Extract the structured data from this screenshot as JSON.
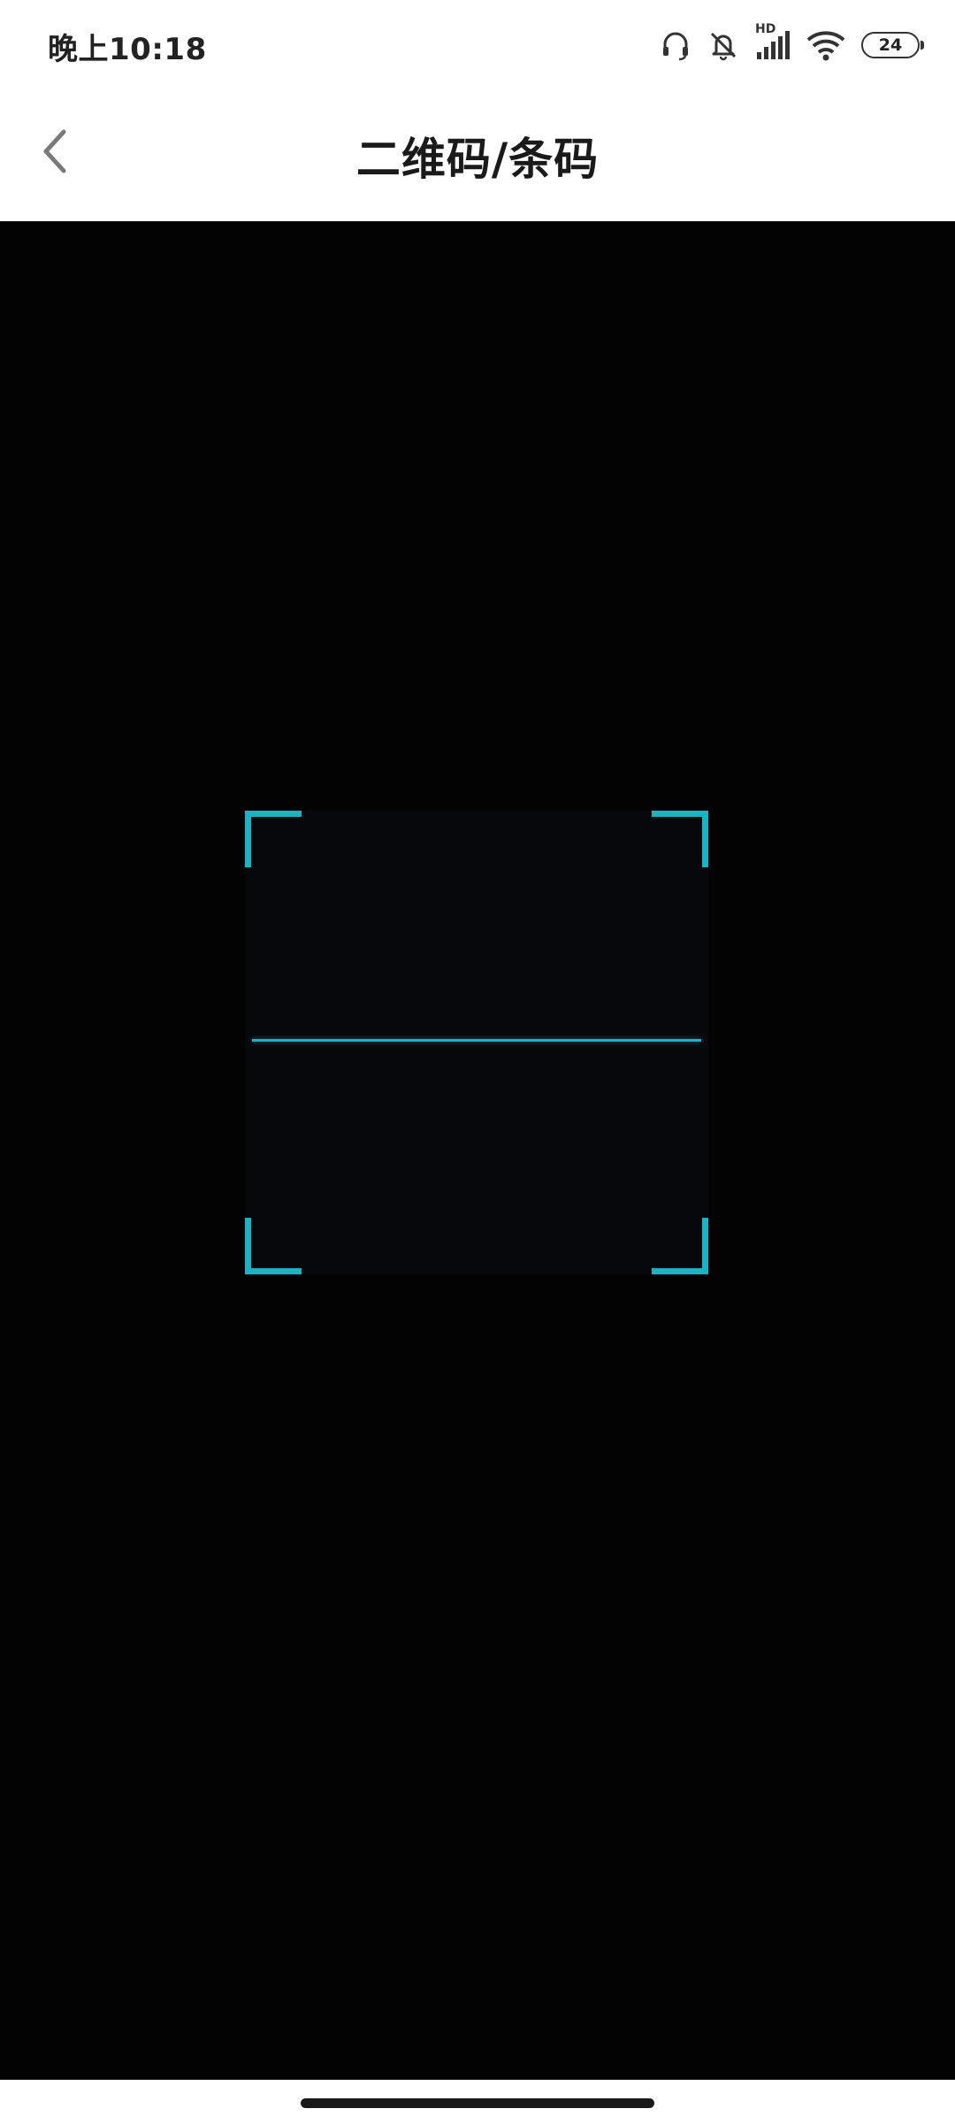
{
  "status_bar": {
    "time": "晚上10:18",
    "network_label": "HD",
    "battery_level": "24",
    "icons": [
      "headset-icon",
      "mute-icon",
      "signal-icon",
      "wifi-icon",
      "battery-icon"
    ]
  },
  "header": {
    "title": "二维码/条码",
    "back_icon": "chevron-left-icon"
  },
  "scanner": {
    "accent_color": "#1ab3c6"
  }
}
